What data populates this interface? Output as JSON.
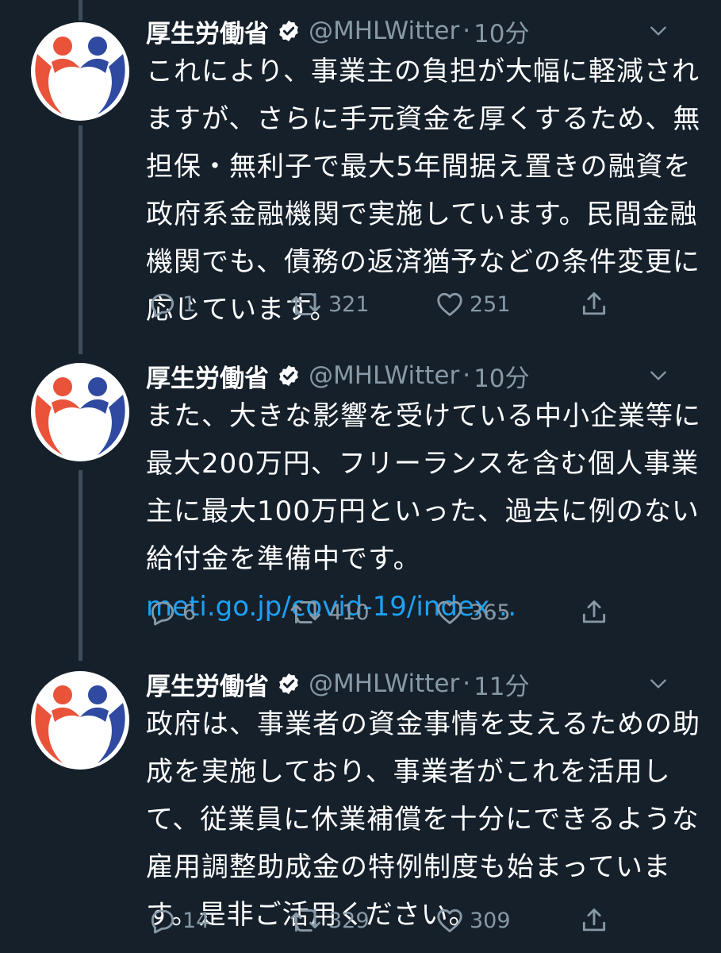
{
  "tweets": [
    {
      "author_name": "厚生労働省",
      "handle": "@MHLWitter",
      "separator": "·",
      "time": "10分",
      "text_lines": [
        "これにより、事業主の負担が大幅に軽減され",
        "ますが、さらに手元資金を厚くするため、無",
        "担保・無利子で最大5年間据え置きの融資を",
        "政府系金融機関で実施しています。民間金融",
        "機関でも、債務の返済猶予などの条件変更に",
        "応じています。"
      ],
      "link": "",
      "replies": "1",
      "retweets": "321",
      "likes": "251"
    },
    {
      "author_name": "厚生労働省",
      "handle": "@MHLWitter",
      "separator": "·",
      "time": "10分",
      "text_lines": [
        "また、大きな影響を受けている中小企業等に",
        "最大200万円、フリーランスを含む個人事業",
        "主に最大100万円といった、過去に例のない",
        "給付金を準備中です。"
      ],
      "link": "meti.go.jp/covid-19/index…",
      "replies": "6",
      "retweets": "410",
      "likes": "365"
    },
    {
      "author_name": "厚生労働省",
      "handle": "@MHLWitter",
      "separator": "·",
      "time": "11分",
      "text_lines": [
        "政府は、事業者の資金事情を支えるための助",
        "成を実施しており、事業者がこれを活用し",
        "て、従業員に休業補償を十分にできるような",
        "雇用調整助成金の特例制度も始まっていま",
        "す。是非ご活用ください。"
      ],
      "link": "",
      "replies": "14",
      "retweets": "329",
      "likes": "309"
    }
  ],
  "icons": {
    "verified": "verified-badge-icon",
    "caret": "chevron-down-icon",
    "reply": "comment-icon",
    "retweet": "retweet-icon",
    "like": "heart-icon",
    "share": "share-icon"
  },
  "colors": {
    "background": "#15202b",
    "text": "#ffffff",
    "muted": "#8899a6",
    "link": "#1da1f2",
    "thread_line": "#3d4d5c",
    "avatar_red": "#e8533a",
    "avatar_blue": "#2f4aa0"
  }
}
